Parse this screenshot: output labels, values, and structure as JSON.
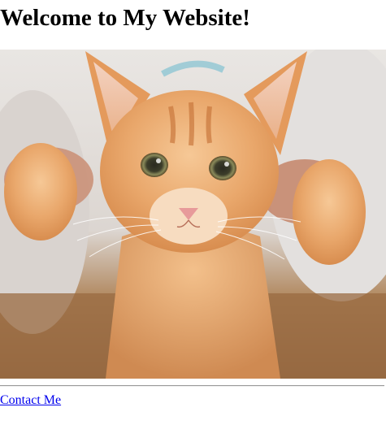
{
  "page": {
    "heading": "Welcome to My Website!",
    "link_color": "#0000ee"
  },
  "hero_image": {
    "subject": "orange tabby kitten",
    "icon": "kitten-photo"
  },
  "footer": {
    "contact_label": "Contact Me"
  }
}
